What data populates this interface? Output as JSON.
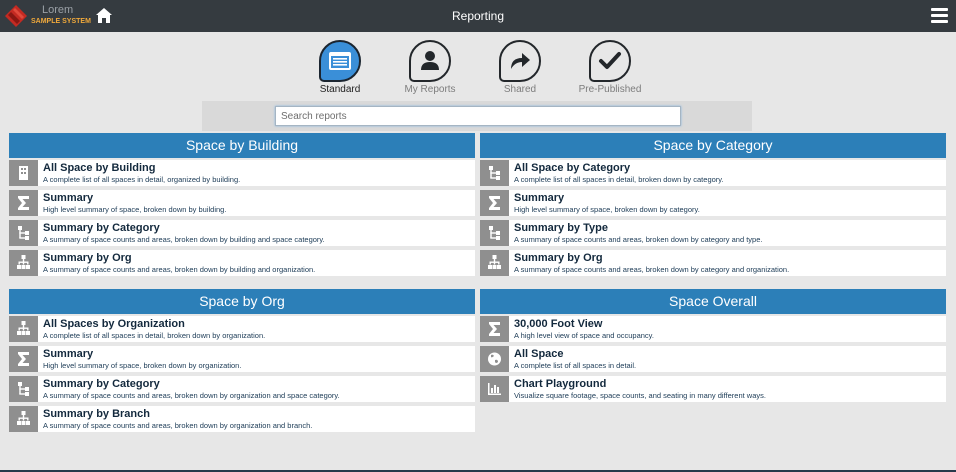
{
  "header": {
    "logo_top": "Lorem",
    "logo_bottom": "SAMPLE SYSTEM",
    "title": "Reporting",
    "home_icon": "home-icon",
    "menu_icon": "hamburger-menu-icon"
  },
  "tabs": [
    {
      "label": "Standard",
      "icon": "list-window-icon",
      "active": true
    },
    {
      "label": "My Reports",
      "icon": "person-icon",
      "active": false
    },
    {
      "label": "Shared",
      "icon": "share-arrow-icon",
      "active": false
    },
    {
      "label": "Pre-Published",
      "icon": "checkmark-icon",
      "active": false
    }
  ],
  "search": {
    "placeholder": "Search reports",
    "value": ""
  },
  "panels": {
    "building": {
      "title": "Space by Building",
      "items": [
        {
          "title": "All Space by Building",
          "desc": "A complete list of all spaces in detail, organized by building.",
          "icon": "building-icon"
        },
        {
          "title": "Summary",
          "desc": "High level summary of space, broken down by building.",
          "icon": "sigma-icon"
        },
        {
          "title": "Summary by Category",
          "desc": "A summary of space counts and areas, broken down by building and space category.",
          "icon": "tree-branch-icon"
        },
        {
          "title": "Summary by Org",
          "desc": "A summary of space counts and areas, broken down by building and organization.",
          "icon": "org-chart-icon"
        }
      ]
    },
    "category": {
      "title": "Space by Category",
      "items": [
        {
          "title": "All Space by Category",
          "desc": "A complete list of all spaces in detail, broken down by category.",
          "icon": "tree-branch-icon"
        },
        {
          "title": "Summary",
          "desc": "High level summary of space, broken down by category.",
          "icon": "sigma-icon"
        },
        {
          "title": "Summary by Type",
          "desc": "A summary of space counts and areas, broken down by category and type.",
          "icon": "tree-branch-icon"
        },
        {
          "title": "Summary by Org",
          "desc": "A summary of space counts and areas, broken down by category and organization.",
          "icon": "org-chart-icon"
        }
      ]
    },
    "org": {
      "title": "Space by Org",
      "items": [
        {
          "title": "All Spaces by Organization",
          "desc": "A complete list of all spaces in detail, broken down by organization.",
          "icon": "org-chart-icon"
        },
        {
          "title": "Summary",
          "desc": "High level summary of space, broken down by organization.",
          "icon": "sigma-icon"
        },
        {
          "title": "Summary by Category",
          "desc": "A summary of space counts and areas, broken down by organization and space category.",
          "icon": "tree-branch-icon"
        },
        {
          "title": "Summary by Branch",
          "desc": "A summary of space counts and areas, broken down by organization and branch.",
          "icon": "org-chart-icon"
        }
      ]
    },
    "overall": {
      "title": "Space Overall",
      "items": [
        {
          "title": "30,000 Foot View",
          "desc": "A high level view of space and occupancy.",
          "icon": "sigma-icon"
        },
        {
          "title": "All Space",
          "desc": "A complete list of all spaces in detail.",
          "icon": "globe-icon"
        },
        {
          "title": "Chart Playground",
          "desc": "Visualize square footage, space counts, and seating in many different ways.",
          "icon": "bar-chart-icon"
        }
      ]
    }
  },
  "colors": {
    "topbar": "#353b40",
    "panel_header": "#2c7fb8",
    "active_tab": "#3a8fd8",
    "icon_bg": "#8f8f8f",
    "background": "#e7e7e7"
  }
}
